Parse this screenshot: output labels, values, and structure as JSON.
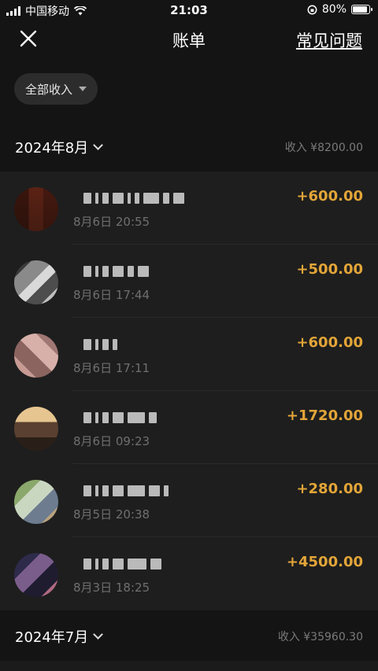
{
  "status_bar": {
    "carrier": "中国移动",
    "time": "21:03",
    "battery": "80%"
  },
  "nav": {
    "title": "账单",
    "faq_label": "常见问题"
  },
  "filter": {
    "label": "全部收入"
  },
  "months": [
    {
      "label": "2024年8月",
      "total": "收入 ¥8200.00"
    },
    {
      "label": "2024年7月",
      "total": "收入 ¥35960.30"
    }
  ],
  "transactions": [
    {
      "time": "8月6日 20:55",
      "amount": "+600.00"
    },
    {
      "time": "8月6日 17:44",
      "amount": "+500.00"
    },
    {
      "time": "8月6日 17:11",
      "amount": "+600.00"
    },
    {
      "time": "8月6日 09:23",
      "amount": "+1720.00"
    },
    {
      "time": "8月5日 20:38",
      "amount": "+280.00"
    },
    {
      "time": "8月3日 18:25",
      "amount": "+4500.00"
    }
  ],
  "colors": {
    "background": "#1b1b1b",
    "header_bg": "#141414",
    "amount": "#e2a538",
    "muted_text": "#6f6f6f"
  }
}
